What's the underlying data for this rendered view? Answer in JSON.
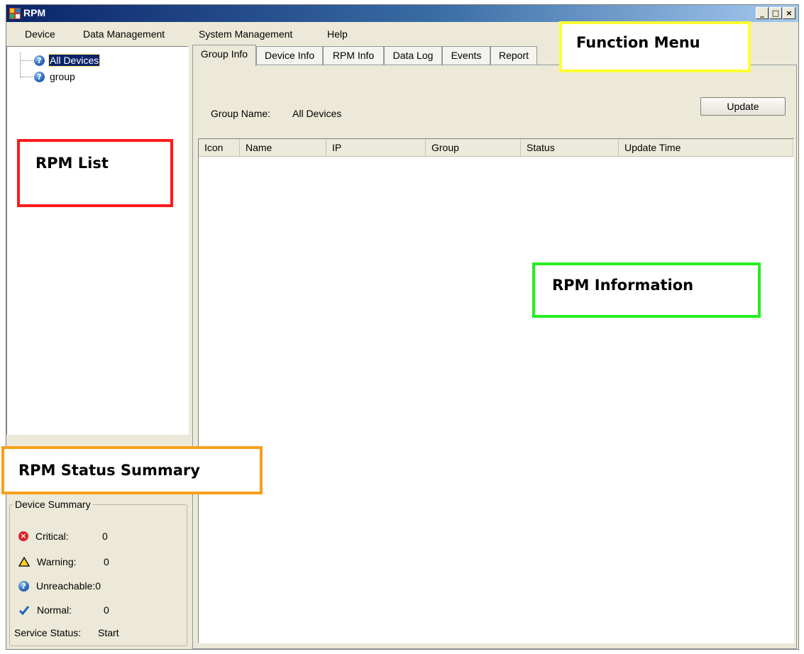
{
  "window": {
    "title": "RPM",
    "controls": [
      "_",
      "□",
      "×"
    ]
  },
  "menu": {
    "items": [
      "Device",
      "Data Management",
      "System Management",
      "Help"
    ]
  },
  "tree": {
    "items": [
      "All Devices",
      "group"
    ]
  },
  "tabs": [
    "Group Info",
    "Device Info",
    "RPM Info",
    "Data Log",
    "Events",
    "Report"
  ],
  "group_info": {
    "group_name_label": "Group Name:",
    "group_name_value": "All Devices",
    "update_button": "Update",
    "columns": [
      "Icon",
      "Name",
      "IP",
      "Group",
      "Status",
      "Update Time"
    ]
  },
  "summary": {
    "title": "Device Summary",
    "rows": [
      {
        "label": "Critical:",
        "value": "0"
      },
      {
        "label": "Warning:",
        "value": "0"
      },
      {
        "label": "Unreachable:",
        "value": "0"
      },
      {
        "label": "Normal:",
        "value": "0"
      }
    ],
    "service_label": "Service Status:",
    "service_value": "Start"
  },
  "callouts": {
    "function_menu": "Function Menu",
    "rpm_list": "RPM List",
    "rpm_information": "RPM Information",
    "rpm_status_summary": "RPM Status Summary"
  },
  "colors": {
    "function_menu": "#ffff33",
    "rpm_list": "#ff1a1a",
    "rpm_information": "#22ee22",
    "rpm_status_summary": "#f7a01c"
  }
}
